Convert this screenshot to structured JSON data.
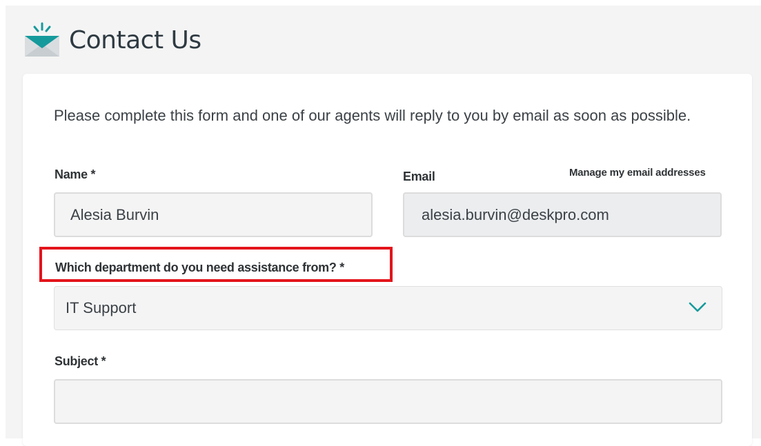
{
  "header": {
    "title": "Contact Us",
    "icon": "envelope-icon"
  },
  "form": {
    "intro": "Please complete this form and one of our agents will reply to you by email as soon as possible.",
    "name": {
      "label": "Name *",
      "value": "Alesia Burvin"
    },
    "email": {
      "label": "Email",
      "value": "alesia.burvin@deskpro.com",
      "manage_link": "Manage my email addresses"
    },
    "department": {
      "label": "Which department do you need assistance from? *",
      "selected": "IT Support"
    },
    "subject": {
      "label": "Subject *",
      "value": ""
    }
  },
  "colors": {
    "accent": "#159a9c",
    "highlight": "#e3141b"
  }
}
